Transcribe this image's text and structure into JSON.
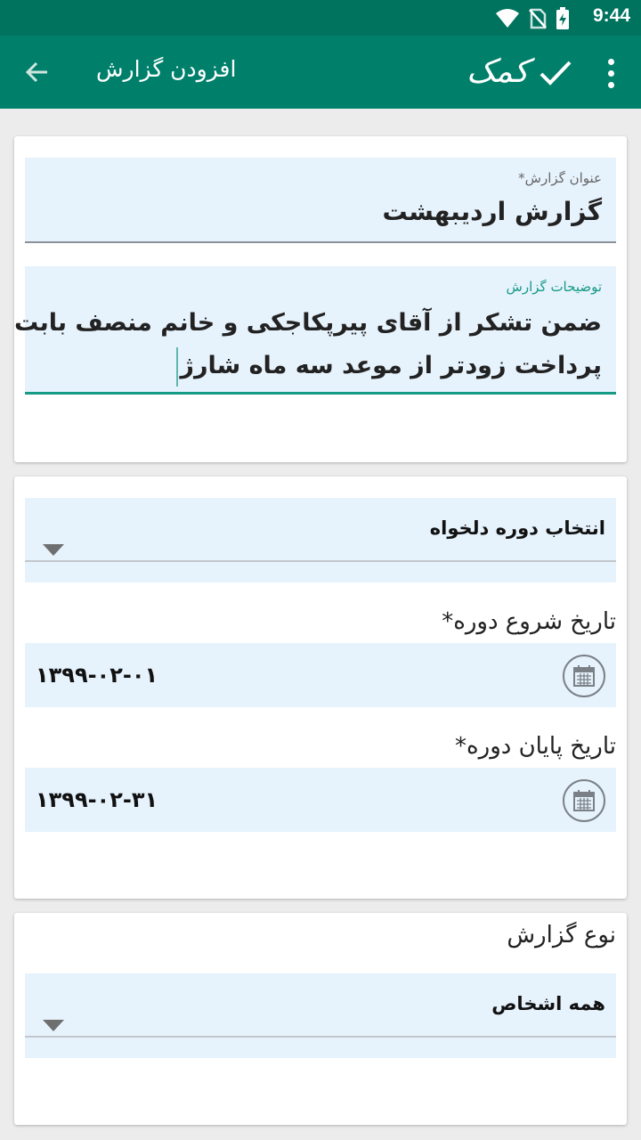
{
  "status_bar": {
    "time": "9:44",
    "icons": [
      "wifi-icon",
      "no-sim-icon",
      "battery-charging-icon"
    ]
  },
  "app_bar": {
    "title": "افزودن گزارش",
    "help_label": "کمک",
    "icons": [
      "back-arrow-icon",
      "check-icon",
      "more-vert-icon"
    ]
  },
  "report": {
    "title_label": "عنوان گزارش*",
    "title_value": "گزارش اردیبهشت",
    "desc_label": "توضیحات گزارش",
    "desc_line1": "ضمن تشکر از آقای پیرپکاجکی و خانم منصف بابت",
    "desc_line2": "پرداخت زودتر از موعد سه ماه شارژ"
  },
  "period": {
    "select_value": "انتخاب دوره دلخواه",
    "start_label": "تاریخ شروع دوره*",
    "start_value": "۱۳۹۹-۰۲-۰۱",
    "end_label": "تاریخ پایان دوره*",
    "end_value": "۱۳۹۹-۰۲-۳۱"
  },
  "report_type": {
    "label": "نوع گزارش",
    "select_value": "همه اشخاص"
  },
  "colors": {
    "primary": "#00806b",
    "status": "#00735f",
    "accent": "#159a86",
    "field_bg": "#e6f2fc"
  }
}
